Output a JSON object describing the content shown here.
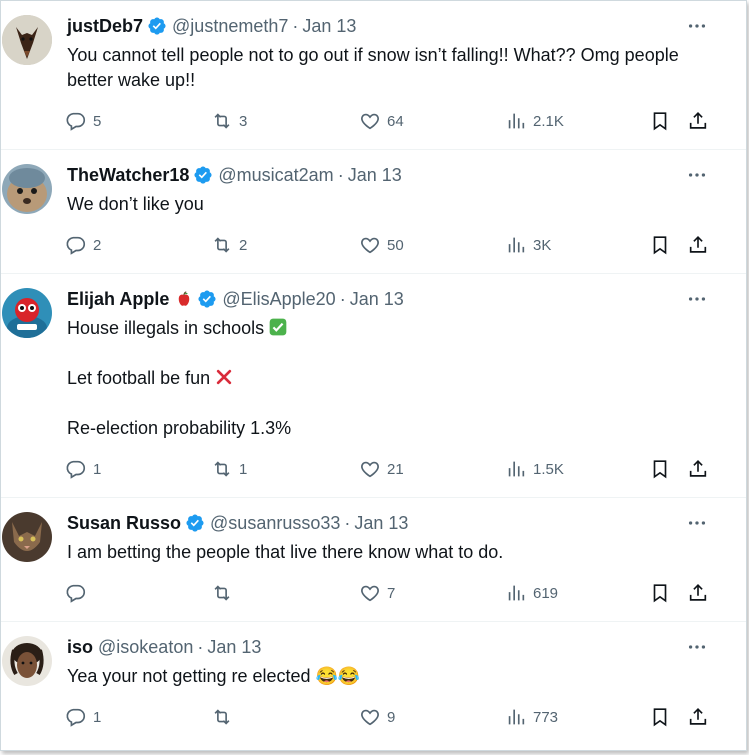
{
  "tweets": [
    {
      "name": "justDeb7",
      "handle": "@justnemeth7",
      "date": "Jan 13",
      "lines": [
        "You cannot tell people not to go out if snow isn’t falling!! What?? Omg people better wake up!!"
      ],
      "replies": "5",
      "retweets": "3",
      "likes": "64",
      "views": "2.1K"
    },
    {
      "name": "TheWatcher18",
      "handle": "@musicat2am",
      "date": "Jan 13",
      "lines": [
        "We don’t like you"
      ],
      "replies": "2",
      "retweets": "2",
      "likes": "50",
      "views": "3K"
    },
    {
      "name": "Elijah Apple",
      "handle": "@ElisApple20",
      "date": "Jan 13",
      "lines": [
        "House illegals in schools",
        "Let football be fun",
        "Re-election probability 1.3%"
      ],
      "replies": "1",
      "retweets": "1",
      "likes": "21",
      "views": "1.5K"
    },
    {
      "name": "Susan Russo",
      "handle": "@susanrusso33",
      "date": "Jan 13",
      "lines": [
        "I am betting the people that live there know what to do."
      ],
      "replies": "",
      "retweets": "",
      "likes": "7",
      "views": "619"
    },
    {
      "name": "iso",
      "handle": "@isokeaton",
      "date": "Jan 13",
      "lines": [
        "Yea your not getting re elected 😂😂"
      ],
      "replies": "1",
      "retweets": "",
      "likes": "9",
      "views": "773"
    }
  ],
  "colors": {
    "verified": "#1d9bf0",
    "text": "#0f1419",
    "muted": "#536471"
  },
  "icons": [
    "reply-icon",
    "retweet-icon",
    "like-icon",
    "views-icon",
    "bookmark-icon",
    "share-icon",
    "more-icon",
    "verified-badge-icon"
  ]
}
